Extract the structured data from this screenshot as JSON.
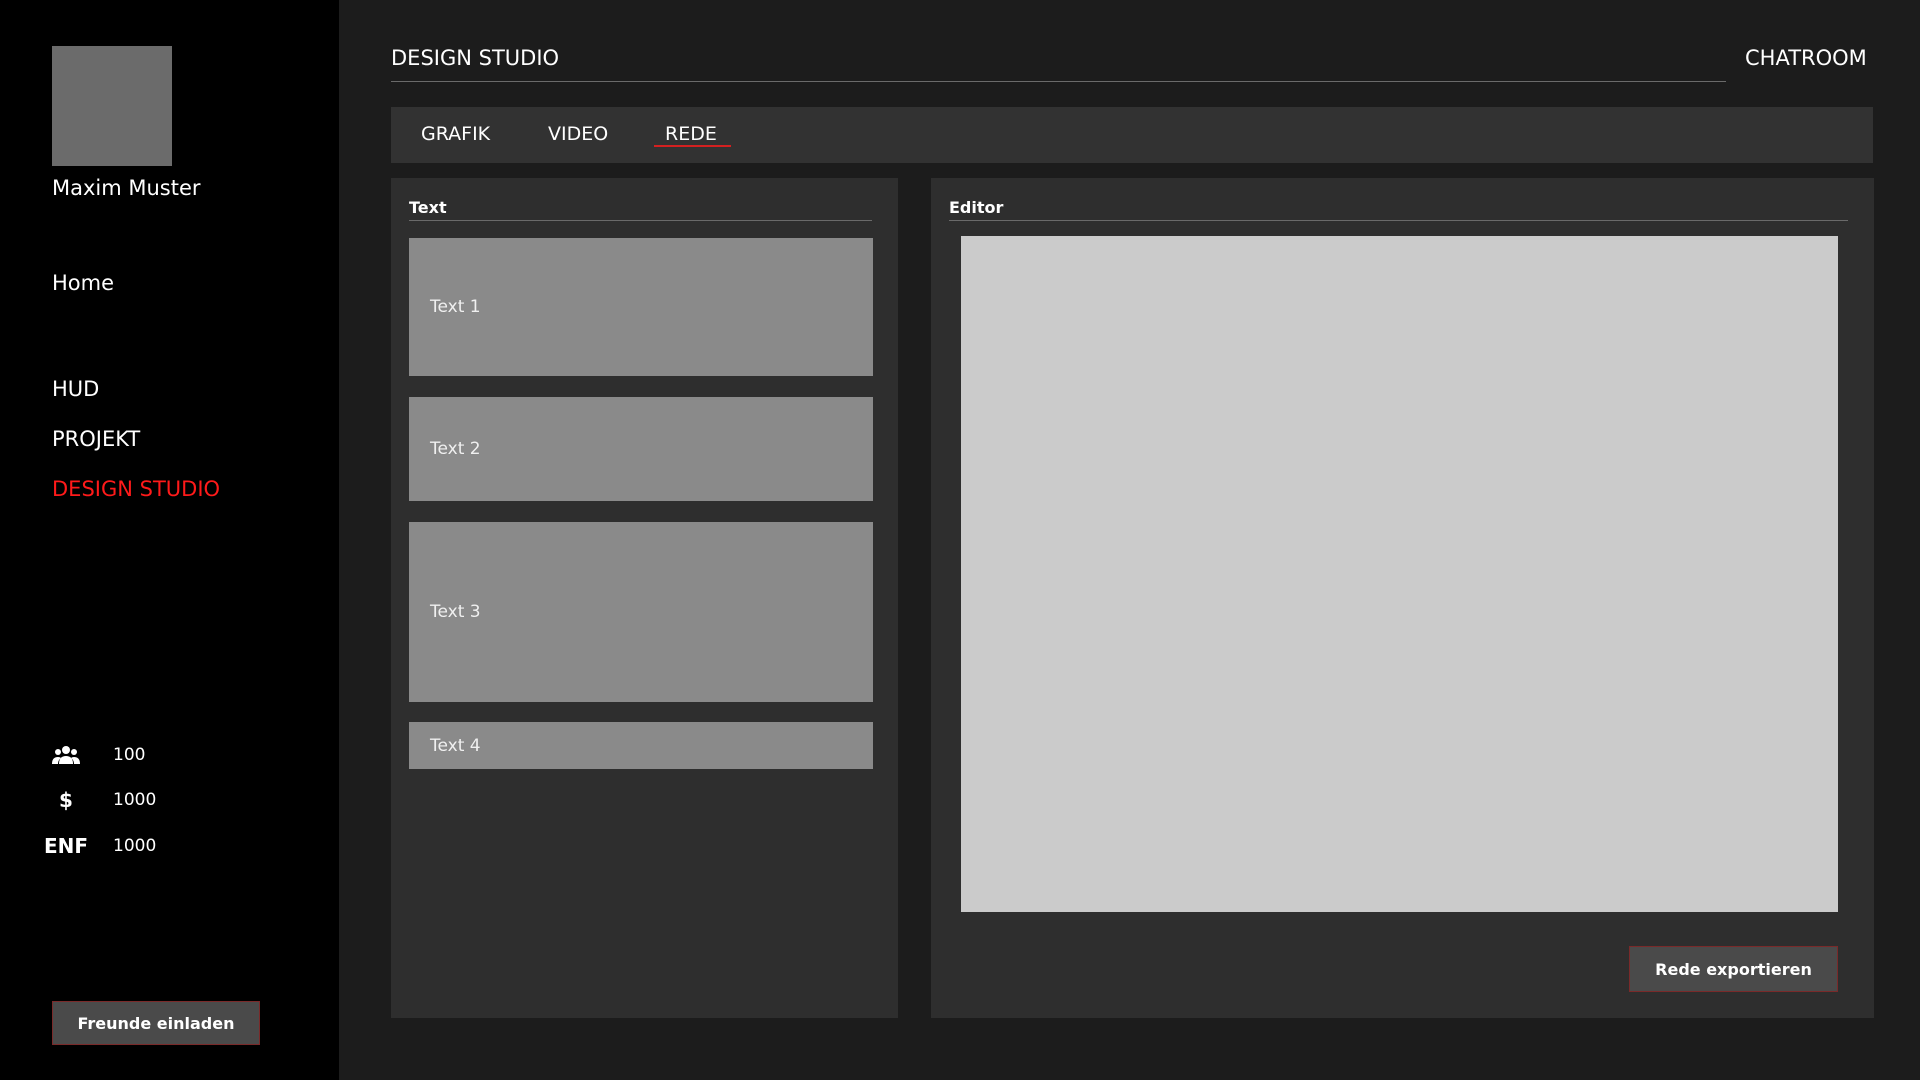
{
  "sidebar": {
    "username": "Maxim Muster",
    "nav": {
      "home": "Home",
      "hud": "HUD",
      "projekt": "PROJEKT",
      "design_studio": "DESIGN STUDIO"
    },
    "stats": {
      "members": {
        "icon": "group-icon",
        "value": "100"
      },
      "money": {
        "icon": "dollar-icon",
        "symbol": "$",
        "value": "1000"
      },
      "energy": {
        "icon": "energy-label",
        "symbol": "ENF",
        "value": "1000"
      }
    },
    "invite_button": "Freunde einladen"
  },
  "header": {
    "title": "DESIGN STUDIO",
    "chatroom": "CHATROOM"
  },
  "tabs": {
    "grafik": "GRAFIK",
    "video": "VIDEO",
    "rede": "REDE",
    "active": "REDE"
  },
  "text_panel": {
    "label": "Text",
    "items": [
      "Text 1",
      "Text 2",
      "Text 3",
      "Text 4"
    ]
  },
  "editor_panel": {
    "label": "Editor",
    "export_button": "Rede exportieren"
  },
  "colors": {
    "accent": "#ff1a1a",
    "sidebar_bg": "#000000",
    "main_bg": "#1c1c1c",
    "panel_bg": "#2e2e2e",
    "card_bg": "#8a8a8a",
    "canvas_bg": "#cbcbcb"
  }
}
